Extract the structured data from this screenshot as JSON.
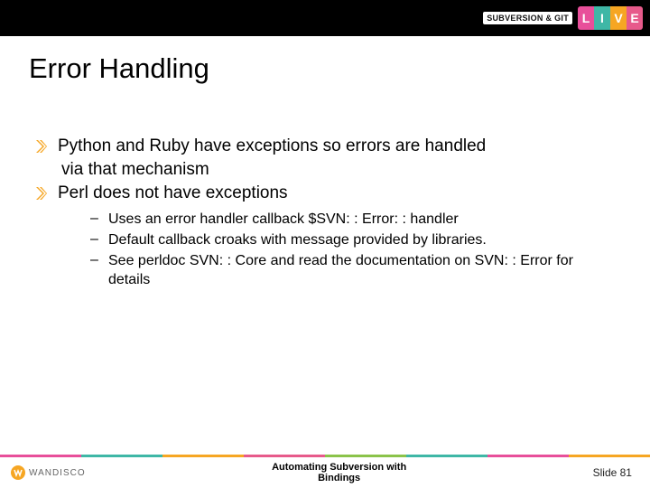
{
  "header": {
    "brand_text": "SUBVERSION & GIT",
    "live": [
      "L",
      "I",
      "V",
      "E"
    ]
  },
  "title": "Error Handling",
  "bullets": [
    {
      "chevron": true,
      "text": "Python and Ruby have exceptions so errors are handled"
    },
    {
      "chevron": false,
      "text": "via that mechanism"
    },
    {
      "chevron": true,
      "text": "Perl does not have exceptions"
    }
  ],
  "sub_bullets": [
    "Uses an error handler callback $SVN: : Error: : handler",
    "Default callback croaks with message provided by libraries.",
    "See perldoc SVN: : Core and read the documentation on SVN: : Error for details"
  ],
  "accent_colors": [
    "#e84f9a",
    "#3fb7a6",
    "#f6a623",
    "#e75a8b",
    "#8bc34a",
    "#3fb7a6",
    "#e84f9a",
    "#f6a623"
  ],
  "footer": {
    "wandisco": "WANDISCO",
    "center": "Automating Subversion with\nBindings",
    "slide": "Slide 81"
  }
}
